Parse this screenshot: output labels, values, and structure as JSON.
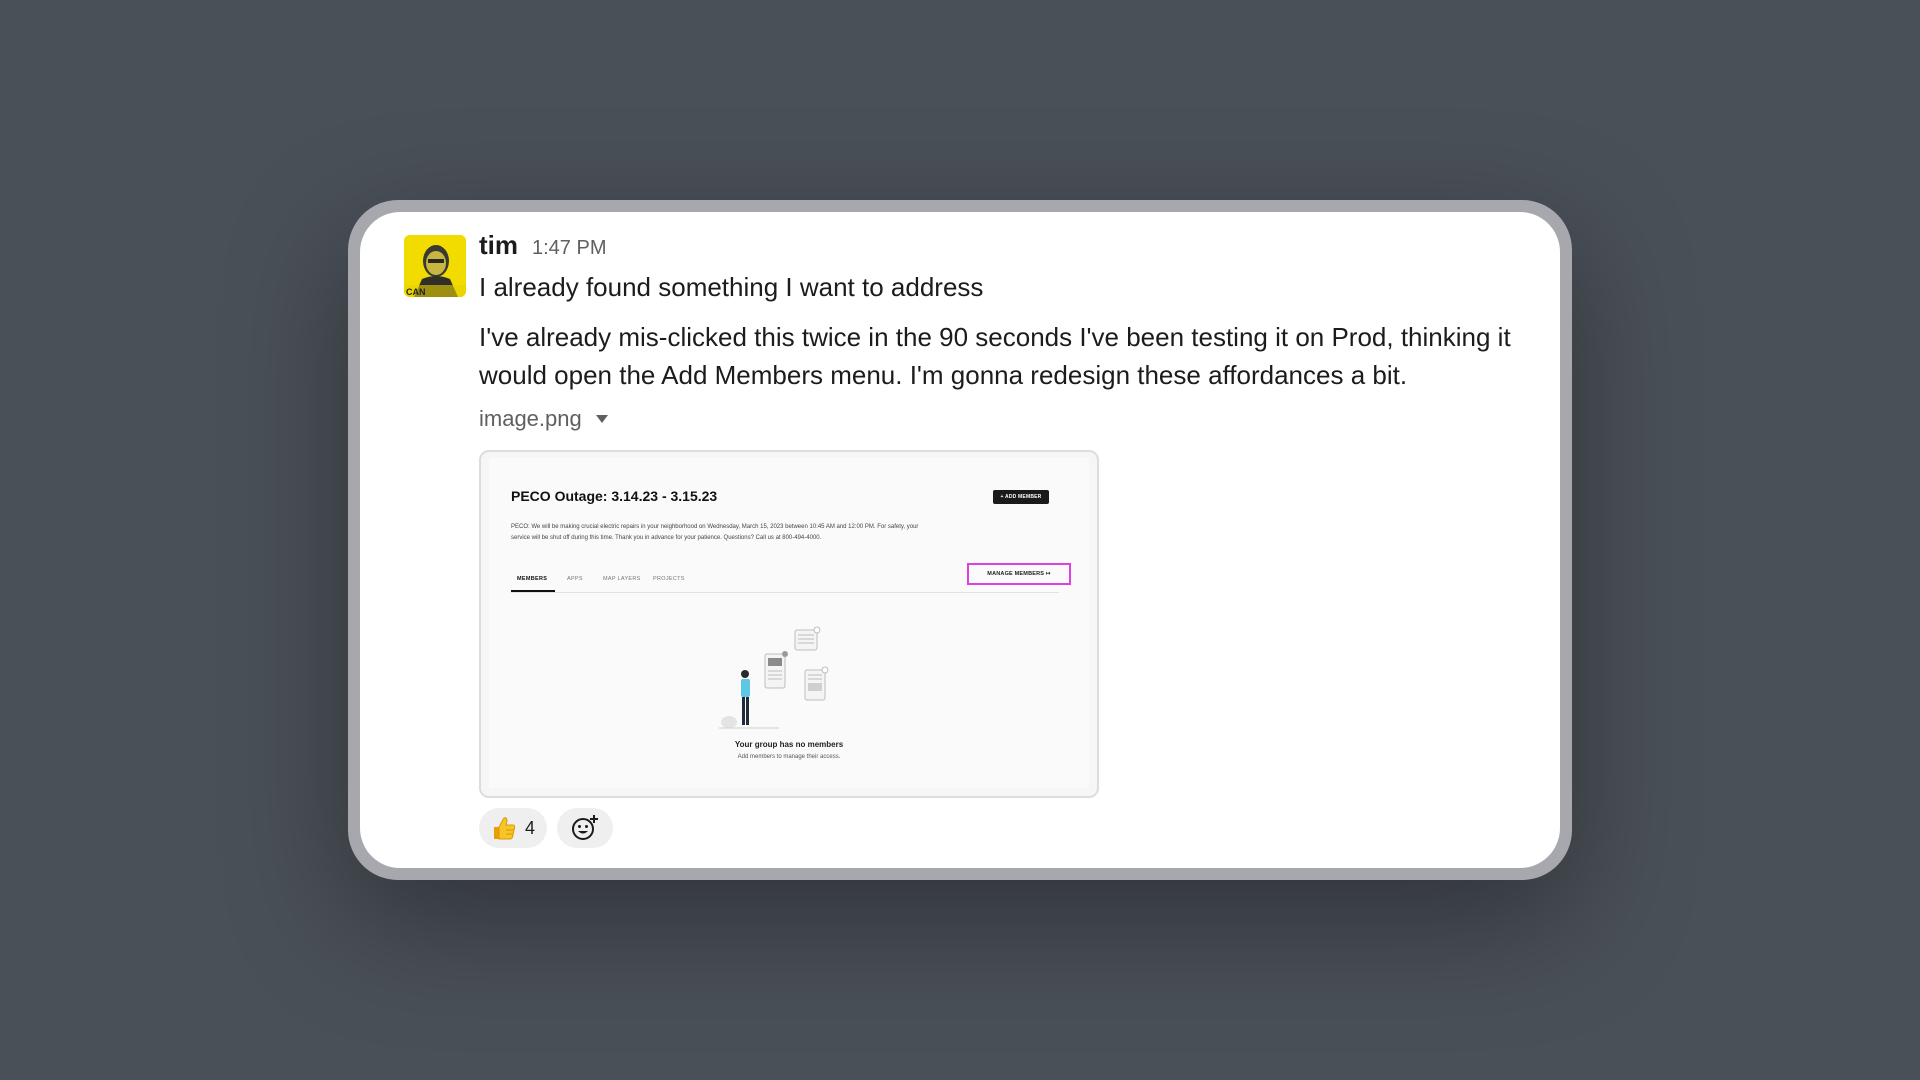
{
  "message": {
    "username": "tim",
    "timestamp": "1:47 PM",
    "line1": "I already found something I want to address",
    "paragraph": "I've already mis-clicked this twice in the 90 seconds I've been testing it on Prod, thinking it would open the Add Members menu. I'm gonna redesign these affordances a bit."
  },
  "attachment": {
    "filename": "image.png",
    "caret_icon": "caret-down-icon"
  },
  "screenshot": {
    "title": "PECO Outage: 3.14.23 - 3.15.23",
    "add_member_label": "+ ADD MEMBER",
    "description": "PECO: We will be making crucial electric repairs in your neighborhood on Wednesday, March 15, 2023 between 10:45 AM and 12:00 PM. For safety, your service will be shut off during this time. Thank you in advance for your patience. Questions? Call us at 800-494-4000.",
    "tabs": [
      {
        "label": "MEMBERS"
      },
      {
        "label": "APPS"
      },
      {
        "label": "MAP LAYERS"
      },
      {
        "label": "PROJECTS"
      }
    ],
    "manage_members_label": "MANAGE MEMBERS ↦",
    "highlight_color": "#e040e0",
    "empty_title": "Your group has no members",
    "empty_subtitle": "Add members to manage their access."
  },
  "reactions": {
    "thumbs_up_icon": "thumbs-up-icon",
    "thumbs_up_count": "4",
    "add_reaction_icon": "add-reaction-icon"
  },
  "colors": {
    "background": "#4a5058",
    "card": "#ffffff",
    "frame": "#a6a8ad"
  }
}
